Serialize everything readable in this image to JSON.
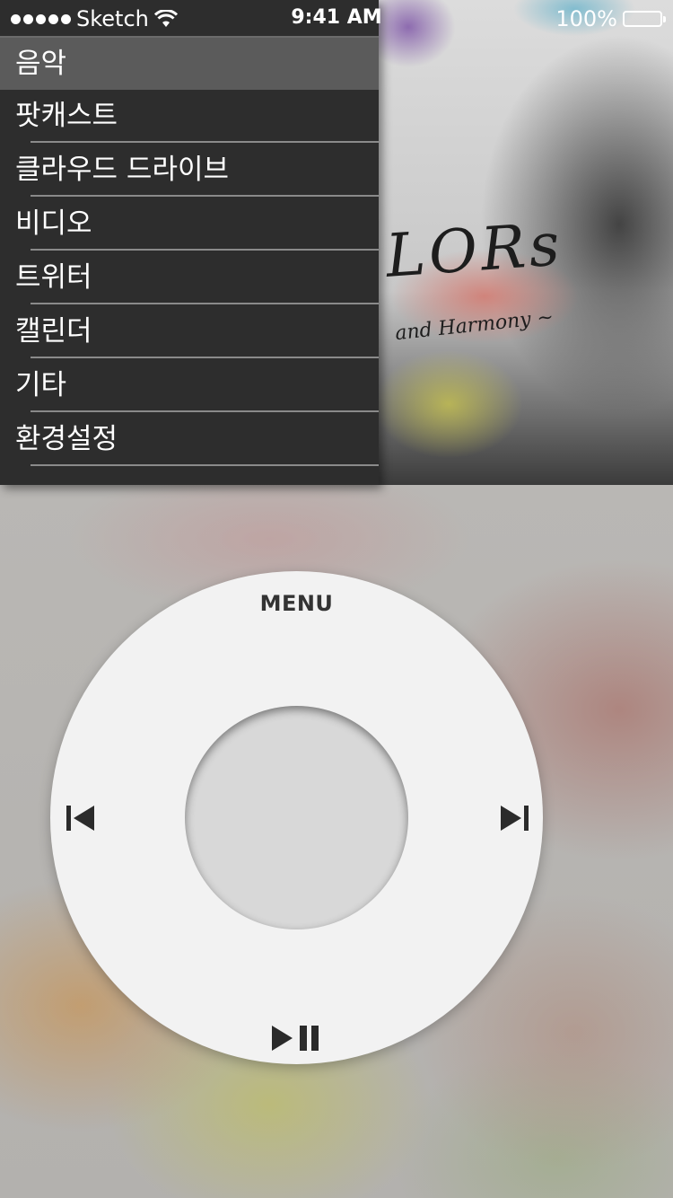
{
  "status_bar": {
    "carrier": "Sketch",
    "time": "9:41 AM",
    "battery": "100%",
    "signal_icon": "signal-dots-icon",
    "wifi_icon": "wifi-icon",
    "battery_icon": "battery-icon"
  },
  "menu": {
    "items": [
      {
        "label": "음악",
        "active": true
      },
      {
        "label": "팟캐스트"
      },
      {
        "label": "클라우드 드라이브"
      },
      {
        "label": "비디오"
      },
      {
        "label": "트위터"
      },
      {
        "label": "캘린더"
      },
      {
        "label": "기타"
      },
      {
        "label": "환경설정"
      }
    ]
  },
  "album": {
    "title_fragment": "LORs",
    "subtitle_fragment": "and Harmony ~"
  },
  "wheel": {
    "menu_label": "MENU",
    "prev_icon": "skip-previous-icon",
    "next_icon": "skip-next-icon",
    "playpause_icon": "play-pause-icon"
  }
}
